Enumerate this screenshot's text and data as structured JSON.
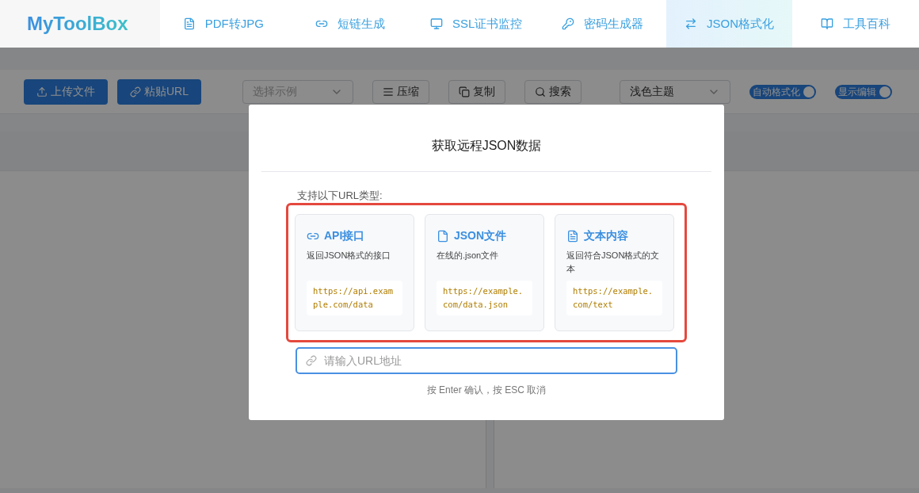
{
  "nav": {
    "logo": "MyToolBox",
    "items": [
      {
        "label": "PDF转JPG",
        "selected": false
      },
      {
        "label": "短链生成",
        "selected": false
      },
      {
        "label": "SSL证书监控",
        "selected": false
      },
      {
        "label": "密码生成器",
        "selected": false
      },
      {
        "label": "JSON格式化",
        "selected": true
      },
      {
        "label": "工具百科",
        "selected": false
      }
    ]
  },
  "toolbar": [
    {
      "kind": "primary",
      "label": "上传文件"
    },
    {
      "kind": "primary",
      "label": "粘贴URL"
    },
    {
      "kind": "select",
      "placeholder": "选择示例"
    },
    {
      "kind": "button",
      "label": "压缩"
    },
    {
      "kind": "button",
      "label": "复制"
    },
    {
      "kind": "button",
      "label": "搜索"
    },
    {
      "kind": "select",
      "value": "浅色主题"
    },
    {
      "kind": "toggle",
      "label": "自动格式化",
      "on": true
    },
    {
      "kind": "toggle",
      "label": "显示编辑",
      "on": true
    }
  ],
  "dialog": {
    "title": "获取远程JSON数据",
    "intro": "支持以下URL类型:",
    "types": [
      {
        "title": "API接口",
        "description": "返回JSON格式的接口",
        "example": "https://api.example.com/data"
      },
      {
        "title": "JSON文件",
        "description": "在线的.json文件",
        "example": "https://example.com/data.json"
      },
      {
        "title": "文本内容",
        "description": "返回符合JSON格式的文本",
        "example": "https://example.com/text"
      }
    ],
    "url_field": {
      "placeholder": "请输入URL地址"
    },
    "hint": "按 Enter 确认，按 ESC 取消"
  }
}
